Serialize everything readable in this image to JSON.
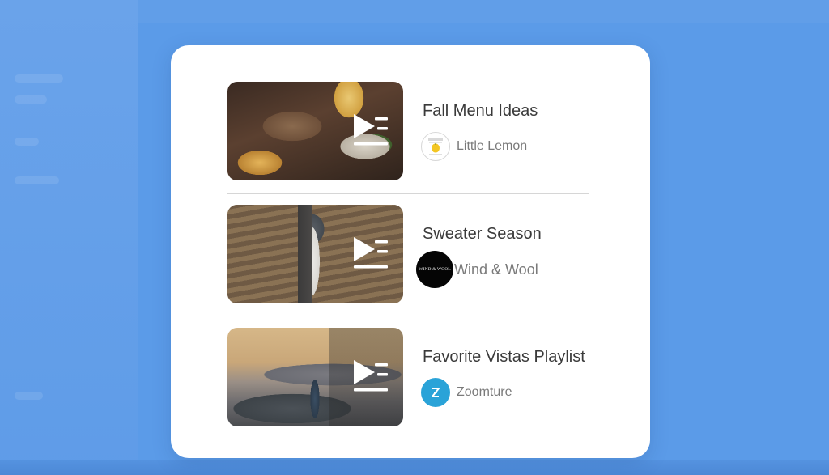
{
  "playlists": [
    {
      "title": "Fall Menu Ideas",
      "channel": "Little Lemon",
      "avatar_icon": "little-lemon-logo"
    },
    {
      "title": "Sweater Season",
      "channel": "Wind & Wool",
      "avatar_text": "WIND & WOOL",
      "avatar_icon": "wind-and-wool-logo"
    },
    {
      "title": "Favorite Vistas Playlist",
      "channel": "Zoomture",
      "avatar_icon": "zoomture-logo"
    }
  ],
  "playlist_icon": "play-playlist-icon",
  "colors": {
    "background": "#5b9be8",
    "card": "#ffffff",
    "title_text": "#3a3a3a",
    "channel_text": "#7a7a7a",
    "zoomture_accent": "#2aa3d8"
  }
}
